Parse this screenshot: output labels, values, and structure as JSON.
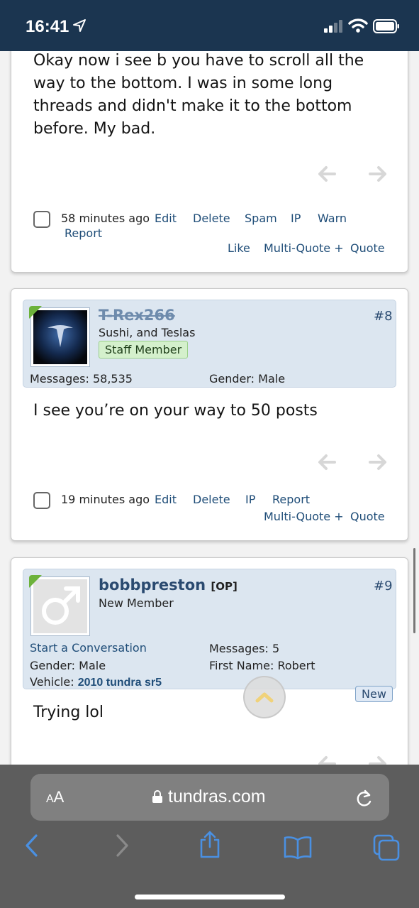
{
  "status": {
    "time": "16:41"
  },
  "posts": [
    {
      "message_lines": [
        "Okay now i see b you have to scroll all the",
        "way to the bottom. I was in some long",
        "threads and didn't make it to the bottom",
        "before. My bad."
      ],
      "time": "58 minutes ago",
      "actions": [
        "Edit",
        "Delete",
        "Spam",
        "IP",
        "Warn",
        "Report"
      ],
      "actions2": [
        "Like",
        "Multi-Quote +",
        "Quote"
      ]
    },
    {
      "number": "#8",
      "username": "T-Rex266",
      "user_title": "Sushi, and Teslas",
      "badge": "Staff Member",
      "messages_label": "Messages:",
      "messages_value": "58,535",
      "gender_label": "Gender:",
      "gender_value": "Male",
      "message": "I see you’re on your way to 50 posts",
      "time": "19 minutes ago",
      "actions": [
        "Edit",
        "Delete",
        "IP",
        "Report"
      ],
      "actions2": [
        "Multi-Quote +",
        "Quote"
      ]
    },
    {
      "number": "#9",
      "username": "bobbpreston",
      "op": "[OP]",
      "user_title": "New Member",
      "start_conversation": "Start a Conversation",
      "messages_label": "Messages:",
      "messages_value": "5",
      "gender_label": "Gender:",
      "gender_value": "Male",
      "first_name_label": "First Name:",
      "first_name_value": "Robert",
      "vehicle_label": "Vehicle:",
      "vehicle_value": "2010 tundra sr5",
      "new_tag": "New",
      "message": "Trying lol"
    }
  ],
  "browser": {
    "aa_small": "A",
    "aa_big": "A",
    "domain": "tundras.com"
  },
  "colors": {
    "statusbar": "#1b3550",
    "link": "#1f4d78",
    "userblock": "#dce6f0"
  }
}
